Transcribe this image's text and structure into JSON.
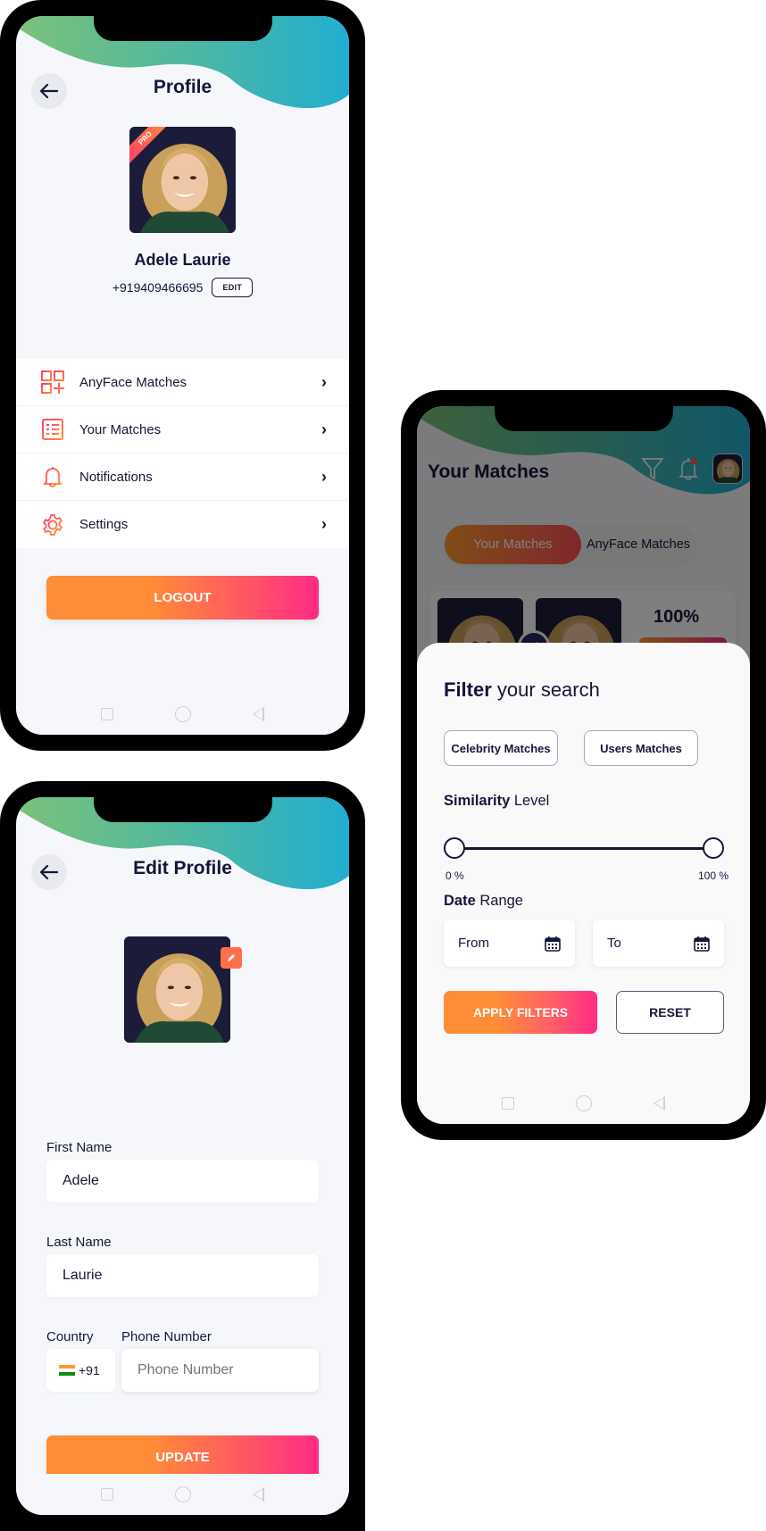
{
  "profile_screen": {
    "title": "Profile",
    "back_label": "back",
    "badge": "PRO",
    "name": "Adele Laurie",
    "phone": "+919409466695",
    "edit_label": "EDIT",
    "menu": [
      {
        "label": "AnyFace Matches",
        "icon": "grid-plus-icon"
      },
      {
        "label": "Your Matches",
        "icon": "list-icon"
      },
      {
        "label": "Notifications",
        "icon": "bell-icon"
      },
      {
        "label": "Settings",
        "icon": "gear-icon"
      }
    ],
    "logout_label": "LOGOUT"
  },
  "edit_profile_screen": {
    "title": "Edit Profile",
    "first_name_label": "First Name",
    "first_name_value": "Adele",
    "last_name_label": "Last Name",
    "last_name_value": "Laurie",
    "country_label": "Country",
    "country_code": "+91",
    "country_flag": "india-flag",
    "phone_label": "Phone Number",
    "phone_placeholder": "Phone Number",
    "phone_value": "",
    "update_label": "UPDATE"
  },
  "matches_screen": {
    "title": "Your Matches",
    "tabs": [
      {
        "label": "Your Matches",
        "active": true
      },
      {
        "label": "AnyFace Matches",
        "active": false
      }
    ],
    "match_card": {
      "percent": "100%"
    },
    "filter_sheet": {
      "title_bold": "Filter",
      "title_rest": " your search",
      "chips": [
        "Celebrity Matches",
        "Users Matches"
      ],
      "similarity_bold": "Similarity",
      "similarity_rest": " Level",
      "similarity_min_label": "0 %",
      "similarity_max_label": "100 %",
      "similarity_range": [
        0,
        100
      ],
      "date_bold": "Date",
      "date_rest": " Range",
      "from_placeholder": "From",
      "to_placeholder": "To",
      "apply_label": "APPLY FILTERS",
      "reset_label": "RESET"
    }
  },
  "colors": {
    "brand_orange": "#ff8c37",
    "brand_pink": "#ff2b85",
    "wave_green": "#78c17a",
    "wave_blue": "#22aed0",
    "text_dark": "#14163a"
  }
}
